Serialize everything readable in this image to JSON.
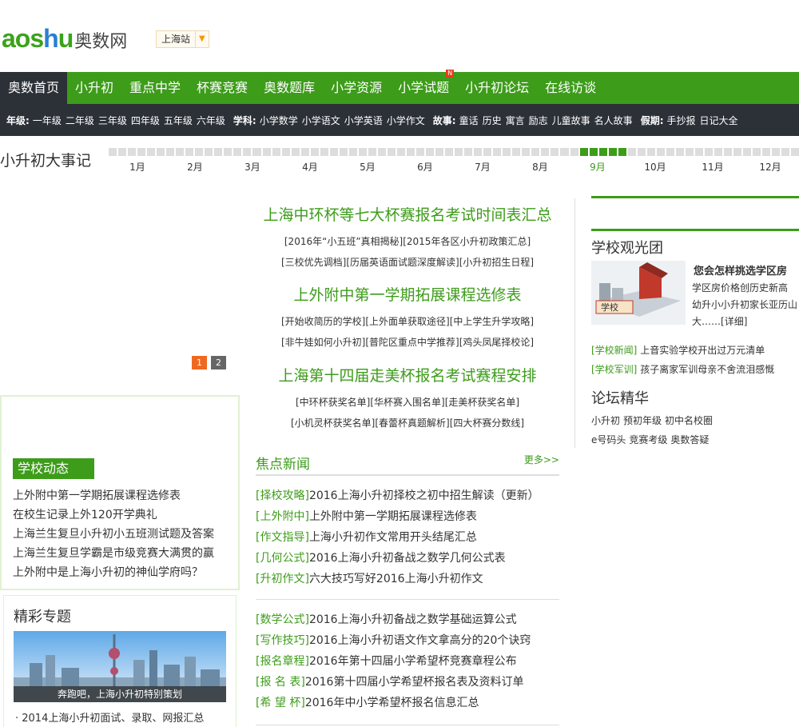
{
  "header": {
    "logo_en_left": "aos",
    "logo_en_u": "h",
    "logo_en_right": "u",
    "logo_cn": "奥数网",
    "city": "上海站"
  },
  "nav": {
    "items": [
      {
        "label": "奥数首页"
      },
      {
        "label": "小升初"
      },
      {
        "label": "重点中学"
      },
      {
        "label": "杯赛竞赛"
      },
      {
        "label": "奥数题库"
      },
      {
        "label": "小学资源"
      },
      {
        "label": "小学试题",
        "badge": "N"
      },
      {
        "label": "小升初论坛"
      },
      {
        "label": "在线访谈"
      }
    ]
  },
  "subnav": {
    "grade_label": "年级:",
    "grades": [
      "一年级",
      "二年级",
      "三年级",
      "四年级",
      "五年级",
      "六年级"
    ],
    "subject_label": "学科:",
    "subjects": [
      "小学数学",
      "小学语文",
      "小学英语",
      "小学作文"
    ],
    "story_label": "故事:",
    "stories": [
      "童话",
      "历史",
      "寓言",
      "励志",
      "儿童故事",
      "名人故事"
    ],
    "holiday_label": "假期:",
    "holidays": [
      "手抄报",
      "日记大全"
    ]
  },
  "timeline": {
    "title": "小升初大事记",
    "months": [
      "1月",
      "2月",
      "3月",
      "4月",
      "5月",
      "6月",
      "7月",
      "8月",
      "9月",
      "10月",
      "11月",
      "12月"
    ],
    "active_month": "9月"
  },
  "slider": {
    "pages": [
      "1",
      "2"
    ]
  },
  "headlines": [
    {
      "title": "上海中环杯等七大杯赛报名考试时间表汇总",
      "links": [
        "[2016年“小五班”真相揭秘]",
        "[2015年各区小升初政策汇总]",
        "[三校优先调档]",
        "[历届英语面试题深度解读]",
        "[小升初招生日程]"
      ]
    },
    {
      "title": "上外附中第一学期拓展课程选修表",
      "links": [
        "[开始收简历的学校]",
        "[上外面单获取途径]",
        "[中上学生升学攻略]",
        "[非牛娃如何小升初]",
        "[普陀区重点中学推荐]",
        "[鸡头凤尾择校论]"
      ]
    },
    {
      "title": "上海第十四届走美杯报名考试赛程安排",
      "links": [
        "[中环杯获奖名单]",
        "[华杯赛入围名单]",
        "[走美杯获奖名单]",
        "[小机灵杯获奖名单]",
        "[春蕾杯真题解析]",
        "[四大杯赛分数线]"
      ]
    }
  ],
  "school_news": {
    "title": "学校动态",
    "items": [
      "上外附中第一学期拓展课程选修表",
      "在校生记录上外120开学典礼",
      "上海兰生复旦小升初小五班测试题及答案",
      "上海兰生复旦学霸是市级竞赛大满贯的赢",
      "上外附中是上海小升初的神仙学府吗？"
    ]
  },
  "topics": {
    "title": "精彩专题",
    "caption": "奔跑吧，上海小升初特别策划",
    "item": "2014上海小升初面试、录取、网报汇总"
  },
  "focus_news": {
    "title": "焦点新闻",
    "more": "更多>>",
    "group1": [
      {
        "tag": "[择校攻略]",
        "text": "2016上海小升初择校之初中招生解读（更新）"
      },
      {
        "tag": "[上外附中]",
        "text": "上外附中第一学期拓展课程选修表"
      },
      {
        "tag": "[作文指导]",
        "text": "上海小升初作文常用开头结尾汇总"
      },
      {
        "tag": "[几何公式]",
        "text": "2016上海小升初备战之数学几何公式表"
      },
      {
        "tag": "[升初作文]",
        "text": "六大技巧写好2016上海小升初作文"
      }
    ],
    "group2": [
      {
        "tag": "[数学公式]",
        "text": "2016上海小升初备战之数学基础运算公式"
      },
      {
        "tag": "[写作技巧]",
        "text": "2016上海小升初语文作文拿高分的20个诀窍"
      },
      {
        "tag": "[报名章程]",
        "text": "2016年第十四届小学希望杯竞赛章程公布"
      },
      {
        "tag": "[报 名 表]",
        "text": "2016第十四届小学希望杯报名表及资料订单"
      },
      {
        "tag": "[希 望 杯]",
        "text": "2016年中小学希望杯报名信息汇总"
      }
    ]
  },
  "school_tour": {
    "title": "学校观光团",
    "feature_title": "您会怎样挑选学区房",
    "feature_body": "学区房价格创历史新高 幼升小小升初家长亚历山大……",
    "feature_more": "[详细]",
    "image_label": "学校",
    "rows": [
      {
        "tag": "[学校新闻]",
        "text": "上音实验学校开出过万元清单"
      },
      {
        "tag": "[学校军训]",
        "text": "孩子离家军训母亲不舍流泪感慨"
      }
    ]
  },
  "forum": {
    "title": "论坛精华",
    "links": [
      "小升初",
      "预初年级",
      "初中名校圈",
      "e号码头",
      "竞赛考级",
      "奥数答疑"
    ]
  },
  "colors": {
    "brand_green": "#3d9c1a",
    "dark_bar": "#2c3138",
    "pager_active": "#f06820"
  }
}
